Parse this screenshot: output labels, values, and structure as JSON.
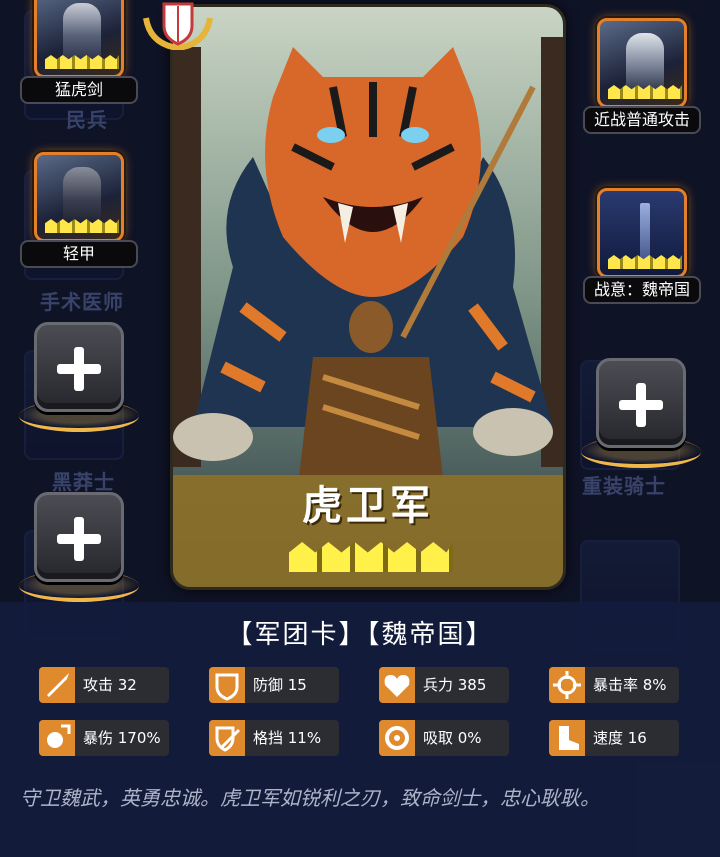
{
  "left_slots": [
    {
      "type": "card",
      "label": "猛虎剑",
      "icon": "tiger-sword-icon"
    },
    {
      "type": "card",
      "label": "轻甲",
      "icon": "light-armor-icon"
    },
    {
      "type": "empty",
      "icon": "plus-icon"
    },
    {
      "type": "empty",
      "icon": "plus-icon"
    }
  ],
  "right_slots": [
    {
      "type": "card",
      "label": "近战普通攻击",
      "icon": "melee-attack-icon"
    },
    {
      "type": "card",
      "label": "战意：魏帝国",
      "icon": "sword-aura-icon"
    },
    {
      "type": "empty",
      "icon": "plus-icon"
    }
  ],
  "background_labels": [
    "民兵",
    "手术医师",
    "黑莽士",
    "重装骑士"
  ],
  "hero": {
    "name": "虎卫军",
    "stars": 5,
    "badge_icon": "shield-laurel-icon"
  },
  "info": {
    "title": "【军团卡】【魏帝国】",
    "stats": [
      {
        "icon": "sword-icon",
        "label": "攻击 32"
      },
      {
        "icon": "shield-icon",
        "label": "防御 15"
      },
      {
        "icon": "heart-icon",
        "label": "兵力 385"
      },
      {
        "icon": "crosshair-icon",
        "label": "暴击率 8%"
      },
      {
        "icon": "burst-icon",
        "label": "暴伤 170%"
      },
      {
        "icon": "parry-icon",
        "label": "格挡 11%"
      },
      {
        "icon": "absorb-icon",
        "label": "吸取 0%"
      },
      {
        "icon": "boot-icon",
        "label": "速度 16"
      }
    ],
    "description": "守卫魏武，英勇忠诚。虎卫军如锐利之刃，致命剑士，忠心耿耿。"
  },
  "colors": {
    "accent": "#e08a2e",
    "panel": "#141c3c",
    "banner": "#8c7028",
    "crown": "#fff04a"
  }
}
